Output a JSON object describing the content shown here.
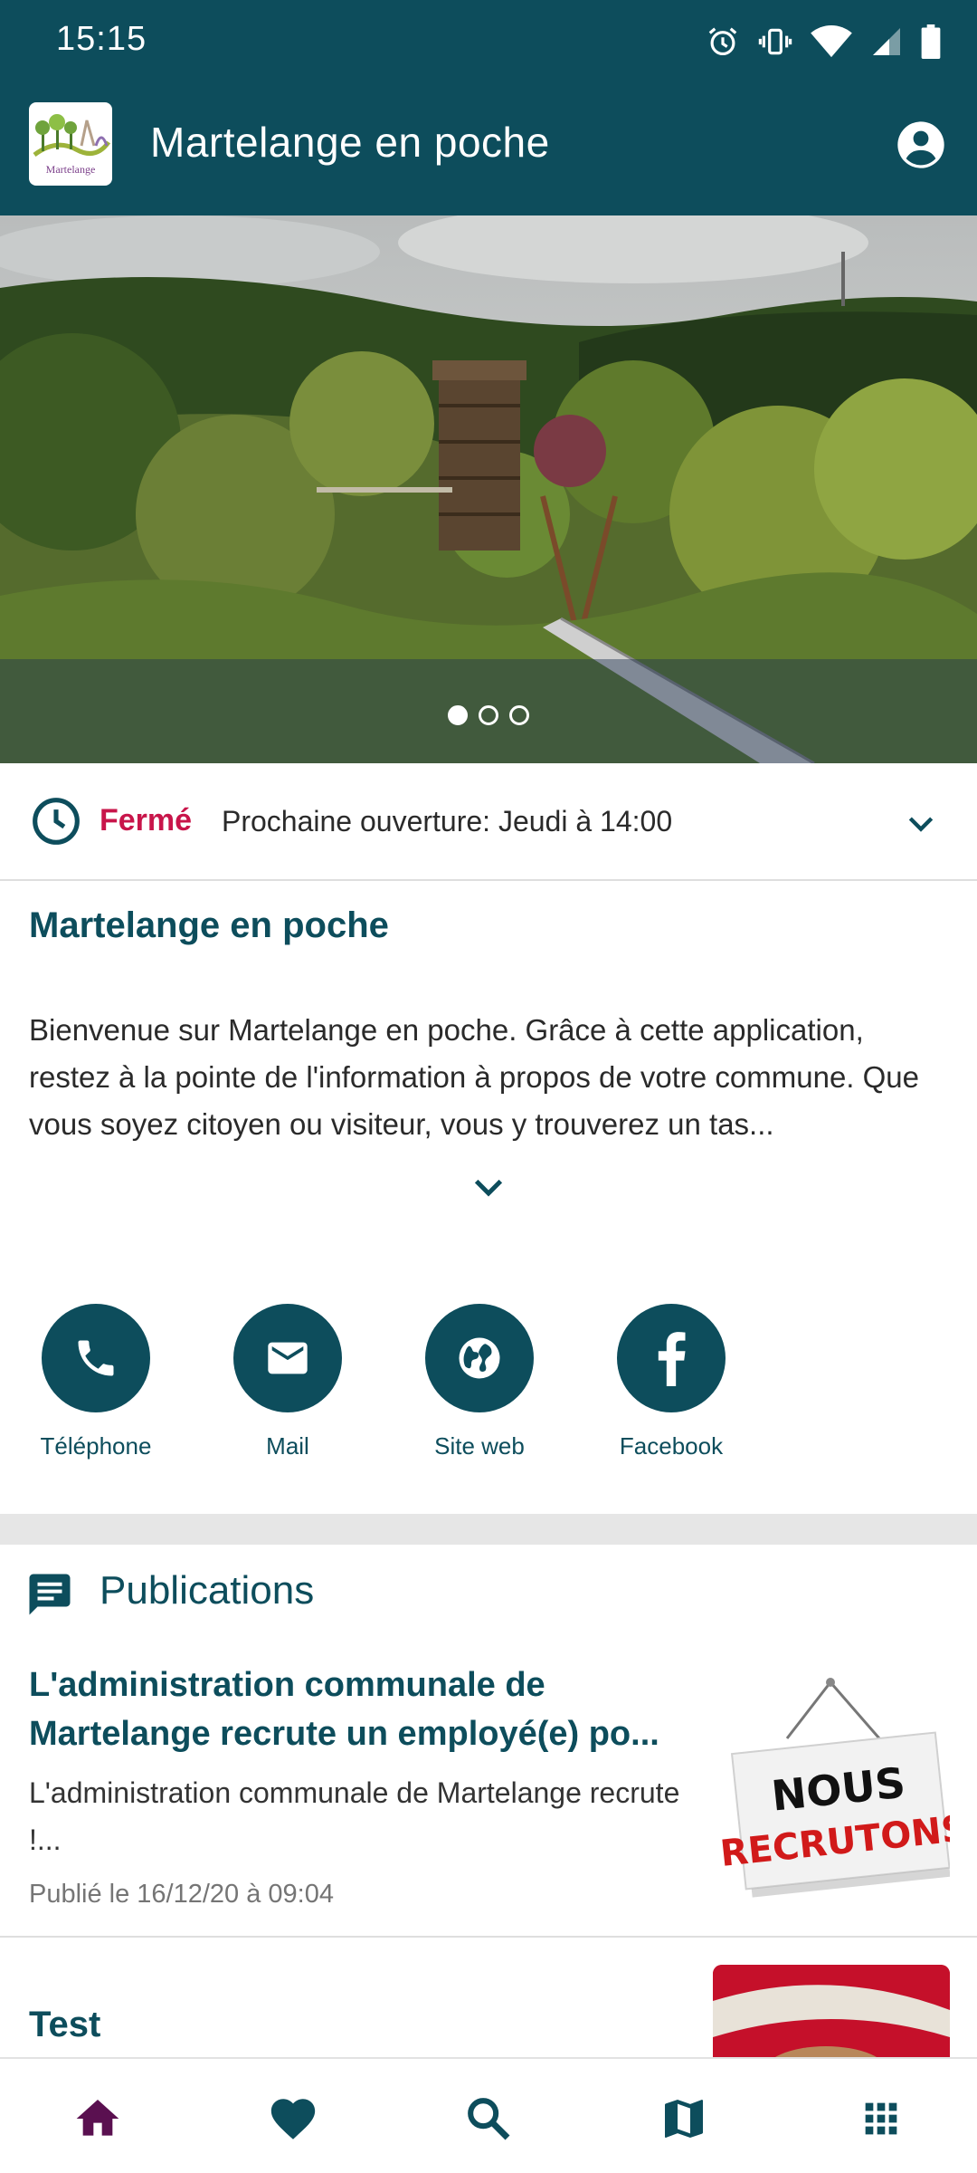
{
  "status_bar": {
    "time": "15:15",
    "icons": [
      "alarm-icon",
      "vibrate-icon",
      "wifi-icon",
      "signal-icon",
      "battery-icon"
    ]
  },
  "app_bar": {
    "title": "Martelange en poche",
    "logo_text": "Martelange",
    "account_icon": "account-circle-icon"
  },
  "hero": {
    "slides_count": 3,
    "active_slide": 1
  },
  "hours": {
    "state": "Fermé",
    "next_opening": "Prochaine ouverture: Jeudi à 14:00"
  },
  "intro": {
    "title": "Martelange en poche",
    "text": "Bienvenue sur Martelange en poche. Grâce à cette application, restez à la pointe de l'information à propos de votre commune. Que vous soyez citoyen ou visiteur, vous y trouverez un tas..."
  },
  "contacts": [
    {
      "label": "Téléphone",
      "icon": "phone-icon"
    },
    {
      "label": "Mail",
      "icon": "mail-icon"
    },
    {
      "label": "Site web",
      "icon": "globe-icon"
    },
    {
      "label": "Facebook",
      "icon": "facebook-icon"
    }
  ],
  "publications": {
    "header": "Publications",
    "items": [
      {
        "title": "L'administration communale de Martelange recrute un employé(e) po...",
        "description": "L'administration communale de Martelange recrute !...",
        "date": "Publié le 16/12/20 à 09:04",
        "thumb_line1": "NOUS",
        "thumb_line2": "RECRUTONS"
      },
      {
        "title": "Test"
      }
    ]
  },
  "bottom_nav": [
    "home-icon",
    "heart-icon",
    "search-icon",
    "map-icon",
    "grid-icon"
  ],
  "colors": {
    "primary": "#0d4d5c",
    "closed": "#c8154a",
    "nav_active": "#5a1050"
  }
}
